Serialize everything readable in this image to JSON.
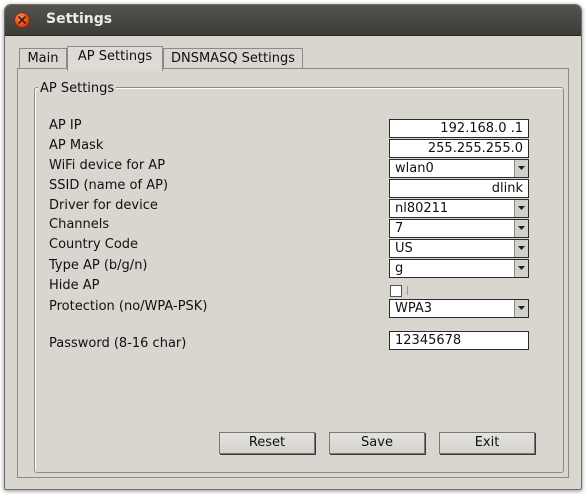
{
  "window": {
    "title": "Settings"
  },
  "tabs": [
    {
      "label": "Main"
    },
    {
      "label": "AP Settings",
      "active": true
    },
    {
      "label": "DNSMASQ Settings"
    }
  ],
  "group": {
    "title": "AP Settings"
  },
  "form": {
    "ap_ip": {
      "label": "AP IP",
      "value": "192.168.0  .1"
    },
    "ap_mask": {
      "label": "AP Mask",
      "value": "255.255.255.0"
    },
    "wifi_device": {
      "label": "WiFi device for AP",
      "value": "wlan0"
    },
    "ssid": {
      "label": "SSID (name of AP)",
      "value": "dlink"
    },
    "driver": {
      "label": "Driver for device",
      "value": "nl80211"
    },
    "channels": {
      "label": "Channels",
      "value": "7"
    },
    "country": {
      "label": "Country Code",
      "value": "US"
    },
    "type_ap": {
      "label": "Type AP (b/g/n)",
      "value": "g"
    },
    "hide_ap": {
      "label": "Hide AP",
      "checked": false
    },
    "protection": {
      "label": "Protection (no/WPA-PSK)",
      "value": "WPA3"
    },
    "password": {
      "label": "Password (8-16 char)",
      "value": "12345678"
    }
  },
  "buttons": {
    "reset": "Reset",
    "save": "Save",
    "exit": "Exit"
  },
  "icons": {
    "close": "close-icon",
    "dropdown": "chevron-down-icon"
  },
  "colors": {
    "titlebar": "#3d3c38",
    "close_button": "#dc4a19",
    "window_bg": "#d9d6d0"
  }
}
